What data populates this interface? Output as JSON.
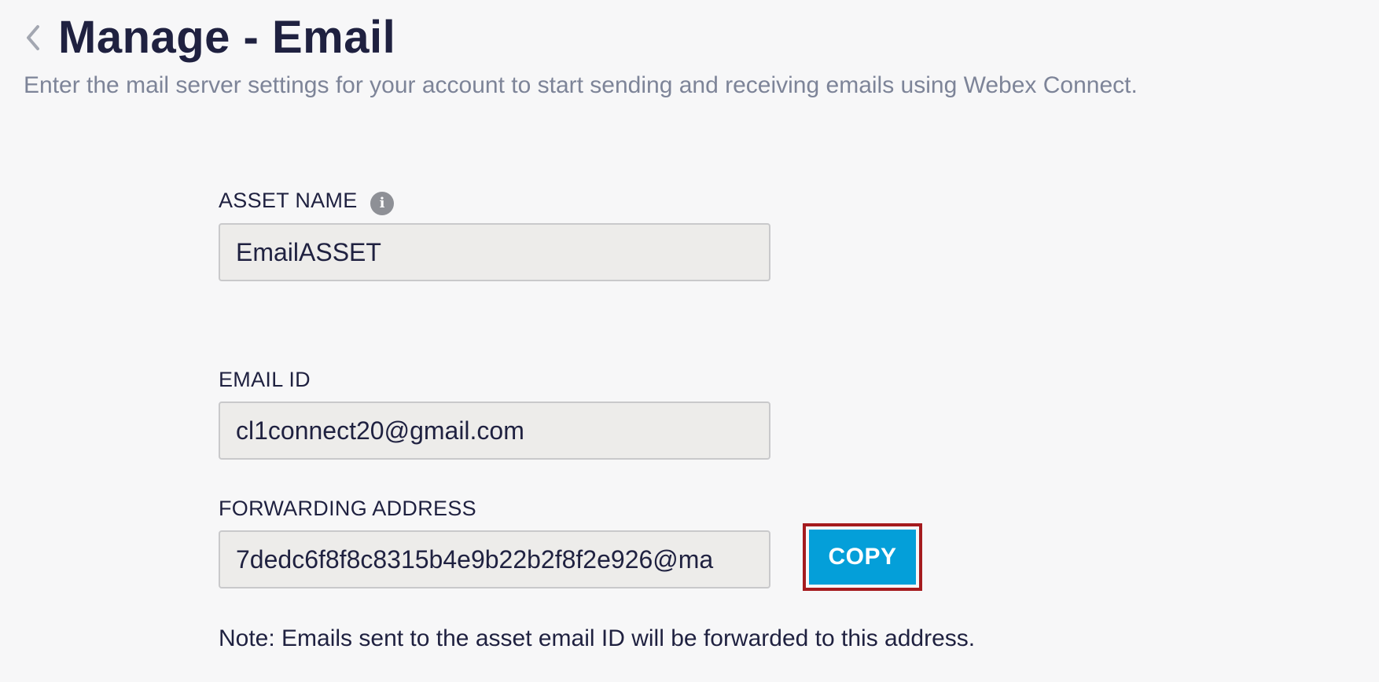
{
  "header": {
    "back_icon": "chevron-left-icon",
    "title": "Manage - Email",
    "subtitle": "Enter the mail server settings for your account to start sending and receiving emails using Webex Connect."
  },
  "form": {
    "asset_name": {
      "label": "ASSET NAME",
      "info_icon": "info-icon",
      "value": "EmailASSET"
    },
    "email_id": {
      "label": "EMAIL ID",
      "value": "cl1connect20@gmail.com"
    },
    "forwarding_address": {
      "label": "FORWARDING ADDRESS",
      "value": "7dedc6f8f8c8315b4e9b22b2f8f2e926@ma",
      "copy_label": "COPY"
    },
    "note": "Note: Emails sent to the asset email ID will be forwarded to this address."
  },
  "colors": {
    "accent": "#049fd9",
    "highlight": "#a51b1e",
    "title": "#1f2140",
    "subtitle": "#7d8498"
  }
}
